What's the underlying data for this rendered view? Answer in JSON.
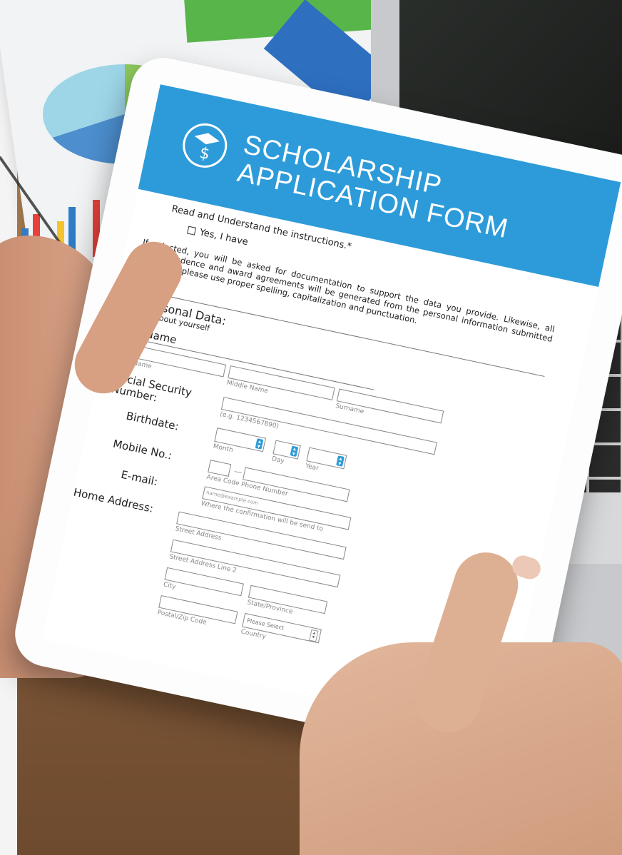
{
  "form": {
    "title_line1": "SCHOLARSHIP",
    "title_line2": "APPLICATION FORM",
    "instruction_question": "Read and Understand the instructions.*",
    "agree_label": "Yes, I have",
    "instruction_text": "If selected, you will be asked for documentation to support the data you provide. Likewise, all correspondence and award agreements will be generated from the personal information submitted below. So, please use proper spelling, capitalization and punctuation.",
    "section_title": "1. Personal Data:",
    "section_subtitle": "Tell us about yourself",
    "fields": {
      "full_name_label": "Full Name",
      "first_name_hint": "First Name",
      "middle_name_hint": "Middle Name",
      "surname_hint": "Surname",
      "ssn_label": "Social Security Number:",
      "ssn_hint": "(e.g. 1234567890)",
      "birthdate_label": "Birthdate:",
      "month_hint": "Month",
      "day_hint": "Day",
      "year_hint": "Year",
      "mobile_label": "Mobile No.:",
      "mobile_dash": "—",
      "mobile_hint": "Area Code Phone Number",
      "email_label": "E-mail:",
      "email_placeholder": "name@example.com",
      "email_hint": "Where the confirmation will be send to",
      "address_label": "Home Address:",
      "street_hint": "Street Address",
      "street2_hint": "Street Address Line 2",
      "city_hint": "City",
      "state_hint": "State/Province",
      "zip_hint": "Postal/Zip Code",
      "country_placeholder": "Please Select",
      "country_hint": "Country"
    }
  },
  "colors": {
    "header_blue": "#2d9bd9"
  },
  "icons": {
    "logo": "graduation-cap-dollar-icon",
    "select_arrow": "spinner-arrows-icon"
  }
}
